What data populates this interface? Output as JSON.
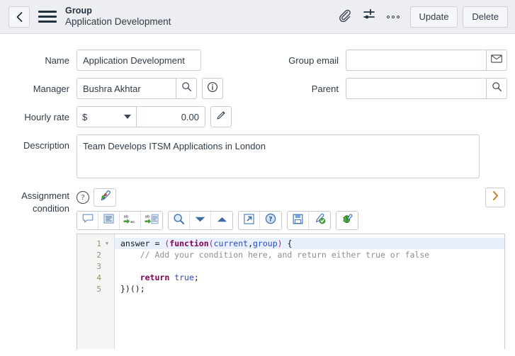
{
  "header": {
    "back_icon": "chevron-left-icon",
    "menu_icon": "hamburger-menu-icon",
    "record_type": "Group",
    "record_title": "Application Development",
    "attachment_icon": "paperclip-icon",
    "personalize_icon": "sliders-icon",
    "more_icon": "more-options-icon",
    "update_label": "Update",
    "delete_label": "Delete"
  },
  "form": {
    "name": {
      "label": "Name",
      "value": "Application Development",
      "placeholder": ""
    },
    "manager": {
      "label": "Manager",
      "value": "Bushra Akhtar",
      "placeholder": "",
      "lookup_icon": "search-icon",
      "info_icon": "info-circle-icon"
    },
    "hourly_rate": {
      "label": "Hourly rate",
      "currency": "$",
      "currency_caret_icon": "chevron-down-icon",
      "amount": "0.00",
      "edit_icon": "pencil-icon"
    },
    "description": {
      "label": "Description",
      "value": "Team Develops ITSM Applications in London",
      "placeholder": ""
    },
    "group_email": {
      "label": "Group email",
      "value": "",
      "placeholder": "",
      "mail_icon": "envelope-icon"
    },
    "parent": {
      "label": "Parent",
      "value": "",
      "placeholder": "",
      "lookup_icon": "search-icon"
    }
  },
  "assignment_condition": {
    "label_line1": "Assignment",
    "label_line2": "condition",
    "help_icon": "question-mark-icon",
    "script_toggle_icon": "script-editor-icon",
    "expand_icon": "chevron-right-icon",
    "toolbar": [
      {
        "name": "comment-icon",
        "group": 1
      },
      {
        "name": "format-text-icon",
        "group": 1
      },
      {
        "name": "replace-icon",
        "group": 1
      },
      {
        "name": "replace-all-icon",
        "group": 1
      },
      {
        "name": "search-icon",
        "group": 2
      },
      {
        "name": "chevron-down-icon",
        "group": 2
      },
      {
        "name": "chevron-up-icon",
        "group": 2
      },
      {
        "name": "open-external-icon",
        "group": 3
      },
      {
        "name": "help-circle-icon",
        "group": 3
      },
      {
        "name": "save-icon",
        "group": 4
      },
      {
        "name": "syntax-check-icon",
        "group": 4
      },
      {
        "name": "debug-bug-icon",
        "group": 5
      }
    ],
    "editor": {
      "lines": [
        {
          "number": "1",
          "foldable": true,
          "active": true,
          "tokens": [
            {
              "t": "answer ",
              "c": "plain"
            },
            {
              "t": "= ",
              "c": "plain"
            },
            {
              "t": "(",
              "c": "punc"
            },
            {
              "t": "function",
              "c": "kw"
            },
            {
              "t": "(",
              "c": "punc"
            },
            {
              "t": "current",
              "c": "ident"
            },
            {
              "t": ",",
              "c": "plain"
            },
            {
              "t": "group",
              "c": "ident"
            },
            {
              "t": ")",
              "c": "punc"
            },
            {
              "t": " {",
              "c": "plain"
            }
          ]
        },
        {
          "number": "2",
          "foldable": false,
          "active": false,
          "tokens": [
            {
              "t": "    // Add your condition here, and return either true or false",
              "c": "cmt"
            }
          ]
        },
        {
          "number": "3",
          "foldable": false,
          "active": false,
          "tokens": []
        },
        {
          "number": "4",
          "foldable": false,
          "active": false,
          "tokens": [
            {
              "t": "    ",
              "c": "plain"
            },
            {
              "t": "return",
              "c": "kw"
            },
            {
              "t": " ",
              "c": "plain"
            },
            {
              "t": "true",
              "c": "ident"
            },
            {
              "t": ";",
              "c": "plain"
            }
          ]
        },
        {
          "number": "5",
          "foldable": false,
          "active": false,
          "tokens": [
            {
              "t": "})();",
              "c": "plain"
            }
          ]
        }
      ]
    }
  },
  "colors": {
    "header_bg": "#eceef1",
    "border": "#c6ccd2",
    "text": "#2e3b47",
    "active_line": "#e8f0fb",
    "keyword": "#7f0055",
    "identifier": "#2b4acb",
    "punctuation": "#a020a0",
    "comment": "#8f8f8f",
    "gutter_number": "#a08a68"
  }
}
